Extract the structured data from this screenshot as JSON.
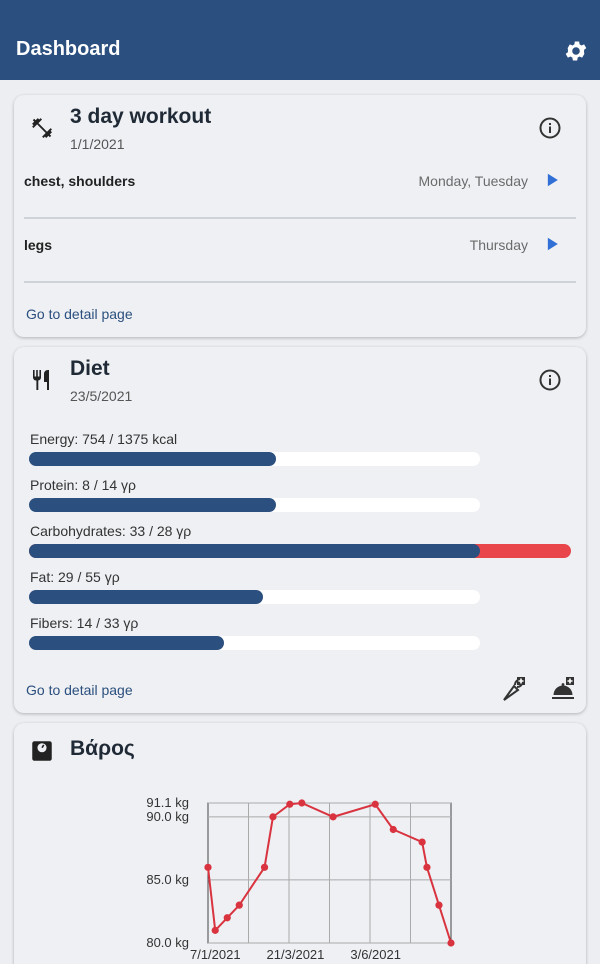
{
  "appbar": {
    "title": "Dashboard"
  },
  "workout": {
    "title": "3 day workout",
    "date": "1/1/2021",
    "exercises": [
      {
        "name": "chest, shoulders",
        "days": "Monday, Tuesday"
      },
      {
        "name": "legs",
        "days": "Thursday"
      }
    ],
    "link": "Go to detail page"
  },
  "diet": {
    "title": "Diet",
    "date": "23/5/2021",
    "nutrients": [
      {
        "label": "Energy: 754 / 1375 kcal",
        "value": 754,
        "target": 1375
      },
      {
        "label": "Protein: 8 / 14 γρ",
        "value": 8,
        "target": 14
      },
      {
        "label": "Carbohydrates: 33 / 28 γρ",
        "value": 33,
        "target": 28
      },
      {
        "label": "Fat: 29 / 55 γρ",
        "value": 29,
        "target": 55
      },
      {
        "label": "Fibers: 14 / 33 γρ",
        "value": 14,
        "target": 33
      }
    ],
    "link": "Go to detail page"
  },
  "weight": {
    "title": "Βάρος"
  },
  "colors": {
    "primary": "#2b4f7e",
    "over": "#e8464a",
    "line": "#d9333f"
  },
  "chart_data": {
    "type": "line",
    "title": "",
    "xlabel": "",
    "ylabel": "",
    "ylim": [
      80.0,
      91.1
    ],
    "ytick_labels": [
      "91.1 kg",
      "90.0 kg",
      "85.0 kg",
      "80.0 kg"
    ],
    "yticks": [
      91.1,
      90.0,
      85.0,
      80.0
    ],
    "xtick_labels": [
      "7/1/2021",
      "21/3/2021",
      "3/6/2021"
    ],
    "x": [
      "2021-01-01",
      "2021-01-07",
      "2021-01-17",
      "2021-01-27",
      "2021-02-17",
      "2021-02-24",
      "2021-03-10",
      "2021-03-20",
      "2021-04-15",
      "2021-05-20",
      "2021-06-04",
      "2021-06-28",
      "2021-07-02",
      "2021-07-12",
      "2021-07-22"
    ],
    "y": [
      86.0,
      81.0,
      82.0,
      83.0,
      86.0,
      90.0,
      91.0,
      91.1,
      90.0,
      91.0,
      89.0,
      88.0,
      86.0,
      83.0,
      80.0
    ],
    "grid": true
  }
}
